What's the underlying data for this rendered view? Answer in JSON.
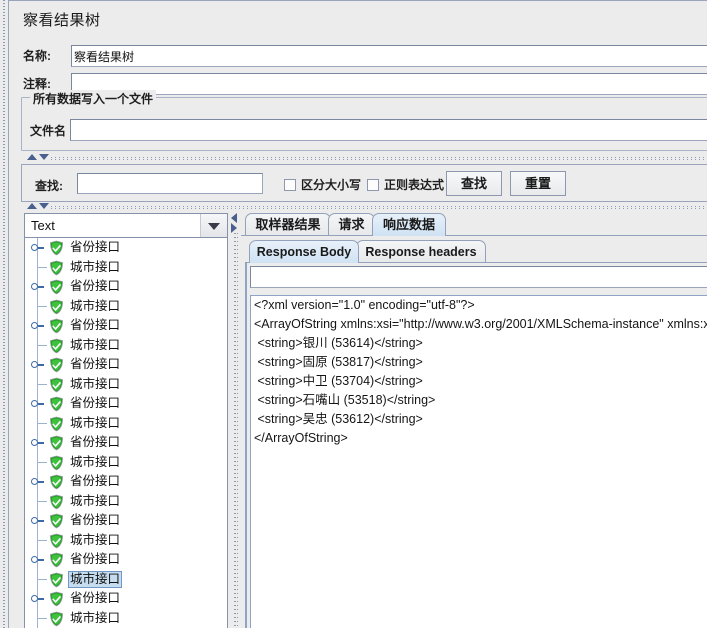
{
  "window": {
    "title": "察看结果树"
  },
  "form": {
    "name_label": "名称:",
    "name_value": "察看结果树",
    "comment_label": "注释:",
    "comment_value": "",
    "comment_placeholder": "",
    "group_title": "所有数据写入一个文件",
    "filename_label": "文件名",
    "filename_value": "",
    "filename_placeholder": ""
  },
  "search": {
    "label": "查找:",
    "value": "",
    "placeholder": "",
    "case_sensitive_label": "区分大小写",
    "case_sensitive_checked": false,
    "regex_label": "正则表达式",
    "regex_checked": false,
    "find_button": "查找",
    "reset_button": "重置"
  },
  "left_panel": {
    "render_combo_value": "Text",
    "render_combo_options": [
      "Text"
    ],
    "tree": {
      "parent_label": "省份接口",
      "child_label": "城市接口",
      "selected_index": 17,
      "nodes": [
        {
          "label": "省份接口",
          "type": "parent",
          "icon": "green-shield-check-icon"
        },
        {
          "label": "城市接口",
          "type": "child",
          "icon": "green-shield-check-icon"
        },
        {
          "label": "省份接口",
          "type": "parent",
          "icon": "green-shield-check-icon"
        },
        {
          "label": "城市接口",
          "type": "child",
          "icon": "green-shield-check-icon"
        },
        {
          "label": "省份接口",
          "type": "parent",
          "icon": "green-shield-check-icon"
        },
        {
          "label": "城市接口",
          "type": "child",
          "icon": "green-shield-check-icon"
        },
        {
          "label": "省份接口",
          "type": "parent",
          "icon": "green-shield-check-icon"
        },
        {
          "label": "城市接口",
          "type": "child",
          "icon": "green-shield-check-icon"
        },
        {
          "label": "省份接口",
          "type": "parent",
          "icon": "green-shield-check-icon"
        },
        {
          "label": "城市接口",
          "type": "child",
          "icon": "green-shield-check-icon"
        },
        {
          "label": "省份接口",
          "type": "parent",
          "icon": "green-shield-check-icon"
        },
        {
          "label": "城市接口",
          "type": "child",
          "icon": "green-shield-check-icon"
        },
        {
          "label": "省份接口",
          "type": "parent",
          "icon": "green-shield-check-icon"
        },
        {
          "label": "城市接口",
          "type": "child",
          "icon": "green-shield-check-icon"
        },
        {
          "label": "省份接口",
          "type": "parent",
          "icon": "green-shield-check-icon"
        },
        {
          "label": "城市接口",
          "type": "child",
          "icon": "green-shield-check-icon"
        },
        {
          "label": "省份接口",
          "type": "parent",
          "icon": "green-shield-check-icon"
        },
        {
          "label": "城市接口",
          "type": "child",
          "icon": "green-shield-check-icon"
        },
        {
          "label": "省份接口",
          "type": "parent",
          "icon": "green-shield-check-icon"
        },
        {
          "label": "城市接口",
          "type": "child",
          "icon": "green-shield-check-icon"
        }
      ]
    }
  },
  "right_panel": {
    "tabs": [
      {
        "label": "取样器结果",
        "active": false
      },
      {
        "label": "请求",
        "active": false
      },
      {
        "label": "响应数据",
        "active": true
      }
    ],
    "subtabs": [
      {
        "label": "Response Body",
        "active": true
      },
      {
        "label": "Response headers",
        "active": false
      }
    ],
    "find_value": "",
    "find_placeholder": "",
    "response_body_lines": [
      "<?xml version=\"1.0\" encoding=\"utf-8\"?>",
      "<ArrayOfString xmlns:xsi=\"http://www.w3.org/2001/XMLSchema-instance\" xmlns:xsd=\"",
      " <string>银川 (53614)</string>",
      " <string>固原 (53817)</string>",
      " <string>中卫 (53704)</string>",
      " <string>石嘴山 (53518)</string>",
      " <string>吴忠 (53612)</string>",
      "</ArrayOfString>"
    ]
  },
  "colors": {
    "panel_bg": "#ececec",
    "border": "#9aa5bb",
    "selection": "#c6ddf0",
    "active_tab": "#cfe2f4",
    "node_icon_green": "#2aa02a",
    "toggle_blue": "#3f6aa8"
  }
}
